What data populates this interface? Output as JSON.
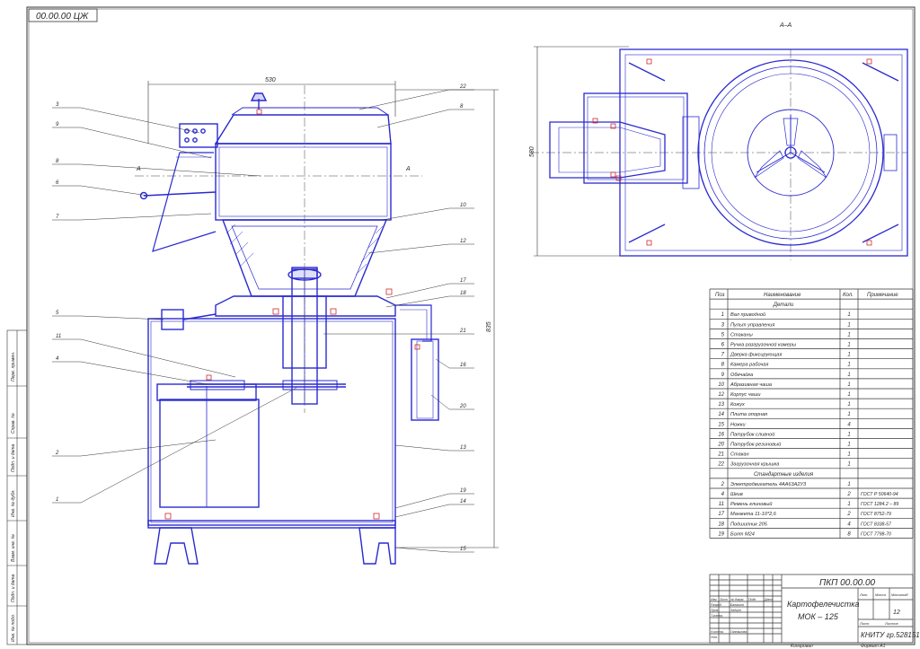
{
  "stamp": "00.00.00 ЦЖ",
  "section_mark": "А–А",
  "cut_letter": "А",
  "dims": {
    "width": "530",
    "height": "835",
    "plan": "580"
  },
  "leaders_left": [
    "3",
    "9",
    "8",
    "6",
    "7",
    "5",
    "11",
    "4",
    "2",
    "1"
  ],
  "leaders_right": [
    "22",
    "8",
    "10",
    "12",
    "17",
    "18",
    "21",
    "16",
    "20",
    "13",
    "19",
    "14",
    "15"
  ],
  "table": {
    "headers": [
      "Поз",
      "Наименование",
      "Кол.",
      "Примечание"
    ],
    "section_details": "Детали",
    "section_std": "Стандартные изделия",
    "rows_details": [
      [
        "1",
        "Вал приводной",
        "1",
        ""
      ],
      [
        "3",
        "Пульт управления",
        "1",
        ""
      ],
      [
        "5",
        "Стаканы",
        "1",
        ""
      ],
      [
        "6",
        "Ручка разгрузочной камеры",
        "1",
        ""
      ],
      [
        "7",
        "Дверка фиксирующая",
        "1",
        ""
      ],
      [
        "8",
        "Камера рабочая",
        "1",
        ""
      ],
      [
        "9",
        "Обечайка",
        "1",
        ""
      ],
      [
        "10",
        "Абразивная чаша",
        "1",
        ""
      ],
      [
        "12",
        "Корпус чаши",
        "1",
        ""
      ],
      [
        "13",
        "Кожух",
        "1",
        ""
      ],
      [
        "14",
        "Плита опорная",
        "1",
        ""
      ],
      [
        "15",
        "Ножки",
        "4",
        ""
      ],
      [
        "16",
        "Патрубок сливной",
        "1",
        ""
      ],
      [
        "20",
        "Патрубок резиновый",
        "1",
        ""
      ],
      [
        "21",
        "Стакан",
        "1",
        ""
      ],
      [
        "22",
        "Загрузочная крышка",
        "1",
        ""
      ]
    ],
    "rows_std": [
      [
        "2",
        "Электродвигатель 4АА63А2У3",
        "1",
        ""
      ],
      [
        "4",
        "Шкив",
        "2",
        "ГОСТ Р 50640-94"
      ],
      [
        "11",
        "Ремень клиновый",
        "1",
        "ГОСТ 1284.2 – 89"
      ],
      [
        "17",
        "Манжета 11-10*2,6",
        "2",
        "ГОСТ 8752-79"
      ],
      [
        "18",
        "Подшипник 205",
        "4",
        "ГОСТ 8338-57"
      ],
      [
        "19",
        "Болт М24",
        "8",
        "ГОСТ 7798-70"
      ]
    ]
  },
  "title_block": {
    "code": "ПКП 00.00.00",
    "name_line1": "Картофелечистка",
    "name_line2": "МОК – 125",
    "org": "КНИТУ гр.528151",
    "sheets": "12",
    "sign_roles": [
      "Разраб.",
      "Пров.",
      "Т.контр.",
      "Н.контр.",
      "Утв."
    ],
    "sign_names": [
      "Балашов",
      "Зайцев",
      "",
      "Ганнашова",
      ""
    ],
    "col_heads": [
      "Изм",
      "Лист",
      "№ докум.",
      "Подп",
      "Дата"
    ],
    "right_heads": [
      "Лит.",
      "Масса",
      "Масштаб"
    ],
    "sheet_label": "Лист",
    "sheets_label": "Листов",
    "copied": "Копировал",
    "format": "Формат А1"
  },
  "side_stamp": [
    "Перв. примен.",
    "Справ. №",
    "Подп. и дата",
    "Инв. № дубл.",
    "Взам. инв. №",
    "Подп. и дата",
    "Инв. № подл."
  ]
}
